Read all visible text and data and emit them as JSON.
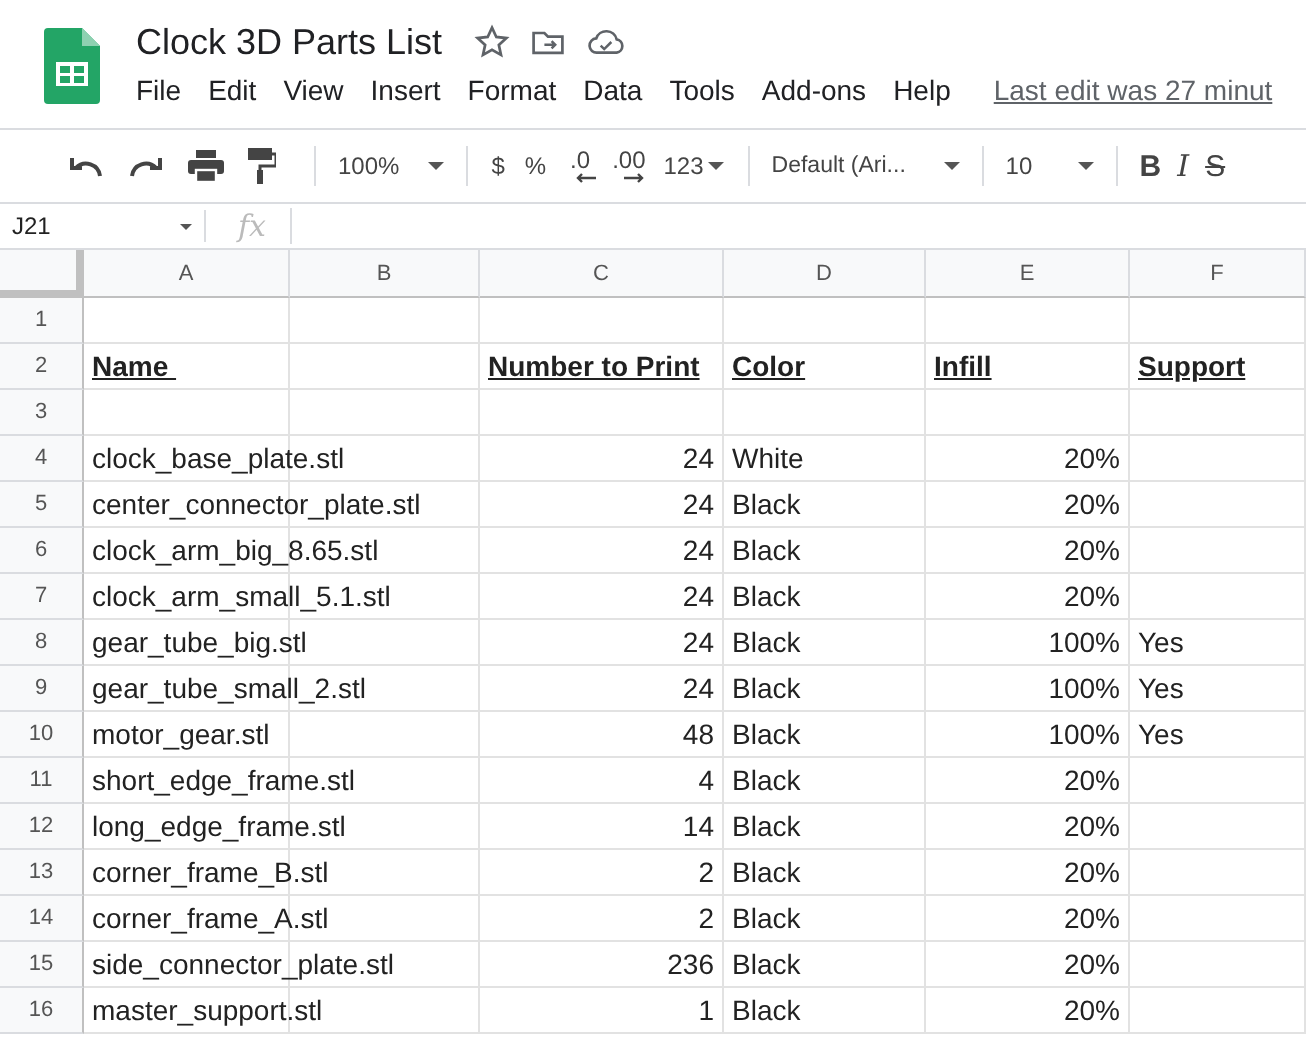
{
  "title": "Clock 3D Parts List",
  "menu": [
    "File",
    "Edit",
    "View",
    "Insert",
    "Format",
    "Data",
    "Tools",
    "Add-ons",
    "Help"
  ],
  "last_edit": "Last edit was 27 minut",
  "toolbar": {
    "zoom": "100%",
    "currency": "$",
    "percent": "%",
    "decimal_decrease": ".0",
    "decimal_increase": ".00",
    "number_format": "123",
    "font": "Default (Ari...",
    "font_size": "10",
    "bold": "B",
    "italic": "I",
    "strikethrough": "S"
  },
  "name_box": "J21",
  "formula_label": "fx",
  "columns": [
    {
      "letter": "A",
      "kind": "text"
    },
    {
      "letter": "B",
      "kind": "text"
    },
    {
      "letter": "C",
      "kind": "number"
    },
    {
      "letter": "D",
      "kind": "text"
    },
    {
      "letter": "E",
      "kind": "number"
    },
    {
      "letter": "F",
      "kind": "text"
    }
  ],
  "rows": [
    {
      "number": "1",
      "kind": "blank",
      "cells": []
    },
    {
      "number": "2",
      "kind": "header",
      "cells": [
        "Name ",
        "",
        "Number to Print",
        "Color",
        "Infill",
        "Support"
      ]
    },
    {
      "number": "3",
      "kind": "blank",
      "cells": []
    },
    {
      "number": "4",
      "kind": "data",
      "cells": [
        "clock_base_plate.stl",
        "",
        "24",
        "White",
        "20%",
        ""
      ]
    },
    {
      "number": "5",
      "kind": "data",
      "cells": [
        "center_connector_plate.stl",
        "",
        "24",
        "Black",
        "20%",
        ""
      ]
    },
    {
      "number": "6",
      "kind": "data",
      "cells": [
        "clock_arm_big_8.65.stl",
        "",
        "24",
        "Black",
        "20%",
        ""
      ]
    },
    {
      "number": "7",
      "kind": "data",
      "cells": [
        "clock_arm_small_5.1.stl",
        "",
        "24",
        "Black",
        "20%",
        ""
      ]
    },
    {
      "number": "8",
      "kind": "data",
      "cells": [
        "gear_tube_big.stl",
        "",
        "24",
        "Black",
        "100%",
        "Yes"
      ]
    },
    {
      "number": "9",
      "kind": "data",
      "cells": [
        "gear_tube_small_2.stl",
        "",
        "24",
        "Black",
        "100%",
        "Yes"
      ]
    },
    {
      "number": "10",
      "kind": "data",
      "cells": [
        "motor_gear.stl",
        "",
        "48",
        "Black",
        "100%",
        "Yes"
      ]
    },
    {
      "number": "11",
      "kind": "data",
      "cells": [
        "short_edge_frame.stl",
        "",
        "4",
        "Black",
        "20%",
        ""
      ]
    },
    {
      "number": "12",
      "kind": "data",
      "cells": [
        "long_edge_frame.stl",
        "",
        "14",
        "Black",
        "20%",
        ""
      ]
    },
    {
      "number": "13",
      "kind": "data",
      "cells": [
        "corner_frame_B.stl",
        "",
        "2",
        "Black",
        "20%",
        ""
      ]
    },
    {
      "number": "14",
      "kind": "data",
      "cells": [
        "corner_frame_A.stl",
        "",
        "2",
        "Black",
        "20%",
        ""
      ]
    },
    {
      "number": "15",
      "kind": "data",
      "cells": [
        "side_connector_plate.stl",
        "",
        "236",
        "Black",
        "20%",
        ""
      ]
    },
    {
      "number": "16",
      "kind": "data",
      "cells": [
        "master_support.stl",
        "",
        "1",
        "Black",
        "20%",
        ""
      ]
    }
  ]
}
